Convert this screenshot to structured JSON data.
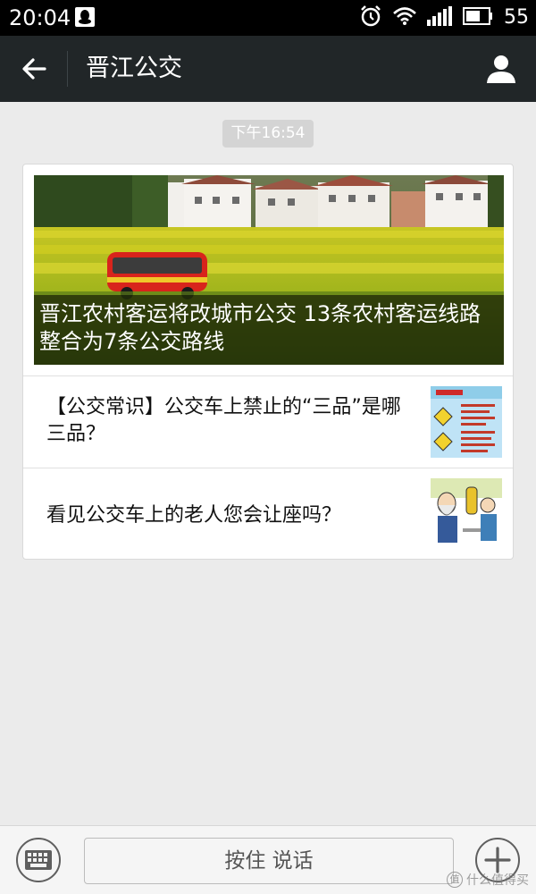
{
  "status_bar": {
    "time": "20:04",
    "battery": "55",
    "icons": [
      "qq-notification-icon",
      "alarm-icon",
      "wifi-icon",
      "signal-icon",
      "battery-icon"
    ]
  },
  "header": {
    "title": "晋江公交",
    "back_icon": "arrow-left-icon",
    "profile_icon": "person-icon"
  },
  "timestamp": "下午16:54",
  "news": {
    "cover_title": "晋江农村客运将改城市公交 13条农村客运线路整合为7条公交路线",
    "items": [
      {
        "text": "【公交常识】公交车上禁止的“三品”是哪三品？",
        "thumb": "three-items-poster"
      },
      {
        "text": "看见公交车上的老人您会让座吗？",
        "thumb": "give-up-seat-cartoon"
      }
    ]
  },
  "input_bar": {
    "hold_to_talk": "按住 说话",
    "keyboard_icon": "keyboard-icon",
    "plus_icon": "plus-icon"
  },
  "watermark": {
    "logo": "值",
    "text": "什么值得买"
  },
  "colors": {
    "title_bar": "#212628",
    "status_bar": "#000000",
    "background": "#ebebeb",
    "card": "#ffffff"
  }
}
